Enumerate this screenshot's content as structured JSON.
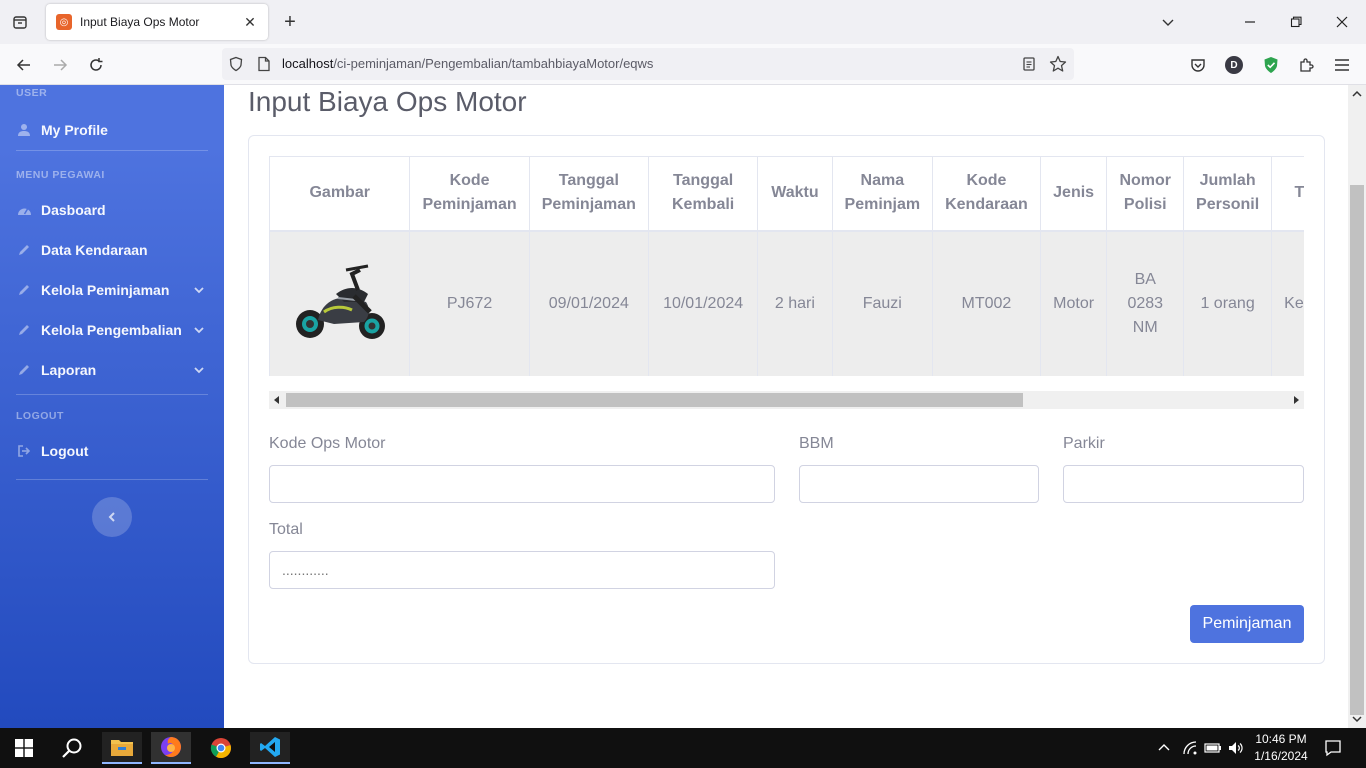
{
  "browser": {
    "tab_title": "Input Biaya Ops Motor",
    "url_host": "localhost",
    "url_path": "/ci-peminjaman/Pengembalian/tambahbiayaMotor/eqws",
    "profile_initial": "D"
  },
  "sidebar": {
    "heading_user": "USER",
    "my_profile": "My Profile",
    "heading_menu": "MENU PEGAWAI",
    "items": [
      {
        "label": "Dasboard",
        "icon": "tachometer-icon"
      },
      {
        "label": "Data Kendaraan",
        "icon": "pencil-icon"
      },
      {
        "label": "Kelola Peminjaman",
        "icon": "pencil-icon"
      },
      {
        "label": "Kelola Pengembalian",
        "icon": "pencil-icon"
      },
      {
        "label": "Laporan",
        "icon": "pencil-icon"
      }
    ],
    "heading_logout": "LOGOUT",
    "logout": "Logout"
  },
  "main": {
    "page_title": "Input Biaya Ops Motor",
    "table": {
      "headers": [
        "Gambar",
        "Kode Peminjaman",
        "Tanggal Peminjaman",
        "Tanggal Kembali",
        "Waktu",
        "Nama Peminjam",
        "Kode Kendaraan",
        "Jenis",
        "Nomor Polisi",
        "Jumlah Personil",
        "Tujuan"
      ],
      "row": {
        "kode_peminjaman": "PJ672",
        "tanggal_peminjaman": "09/01/2024",
        "tanggal_kembali": "10/01/2024",
        "waktu": "2 hari",
        "nama_peminjam": "Fauzi",
        "kode_kendaraan": "MT002",
        "jenis": "Motor",
        "nomor_polisi": "BA 0283 NM",
        "jumlah_personil": "1 orang",
        "tujuan": "Kep"
      }
    },
    "form": {
      "kode_ops_motor_label": "Kode Ops Motor",
      "kode_ops_motor_value": "",
      "bbm_label": "BBM",
      "bbm_value": "",
      "parkir_label": "Parkir",
      "parkir_value": "",
      "total_label": "Total",
      "total_placeholder": "............"
    },
    "submit_label": "Peminjaman"
  },
  "taskbar": {
    "time": "10:46 PM",
    "date": "1/16/2024"
  },
  "colors": {
    "sidebar_top": "#4e73df",
    "sidebar_bottom": "#224abe",
    "primary_button": "#4e73df",
    "text_muted": "#858796"
  }
}
